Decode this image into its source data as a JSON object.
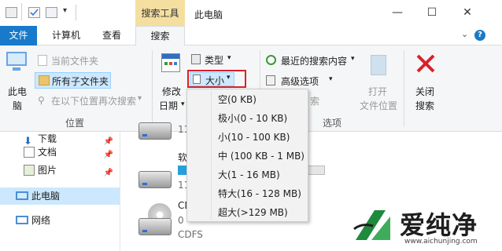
{
  "titlebar": {
    "context_tab": "搜索工具",
    "window_title": "此电脑",
    "minimize": "—",
    "maximize": "☐",
    "close": "✕"
  },
  "tabs": {
    "file": "文件",
    "computer": "计算机",
    "view": "查看",
    "search": "搜索"
  },
  "ribbon": {
    "location": {
      "this_pc_line1": "此电",
      "this_pc_line2": "脑",
      "current_folder": "当前文件夹",
      "all_subfolders": "所有子文件夹",
      "search_again": "在以下位置再次搜索",
      "group_label": "位置"
    },
    "refine": {
      "modified_line1": "修改",
      "modified_line2": "日期",
      "type": "类型",
      "size": "大小",
      "highlight_color": "#d9202a"
    },
    "options": {
      "recent_searches": "最近的搜索内容",
      "advanced_options": "高级选项",
      "partial_text": "索",
      "open_location_line1": "打开",
      "open_location_line2": "文件位置",
      "group_label": "选项"
    },
    "close": {
      "line1": "关闭",
      "line2": "搜索"
    }
  },
  "nav": {
    "downloads": "下载",
    "documents": "文档",
    "pictures": "图片",
    "this_pc": "此电脑",
    "network": "网络"
  },
  "main": {
    "drive1_partial": "11",
    "drive2_label_partial": "软",
    "drive2_size_partial": "11",
    "drive3_label_partial": "CD",
    "drive3_size_partial": "0",
    "drive3_fs": "CDFS"
  },
  "size_dropdown": {
    "items": [
      "空(0 KB)",
      "极小(0 - 10 KB)",
      "小(10 - 100 KB)",
      "中 (100 KB - 1 MB)",
      "大(1 - 16 MB)",
      "特大(16 - 128 MB)",
      "超大(>129 MB)"
    ]
  },
  "watermark": {
    "text": "爱纯净",
    "url": "www.aichunjing.com",
    "color": "#1e8a3c"
  }
}
